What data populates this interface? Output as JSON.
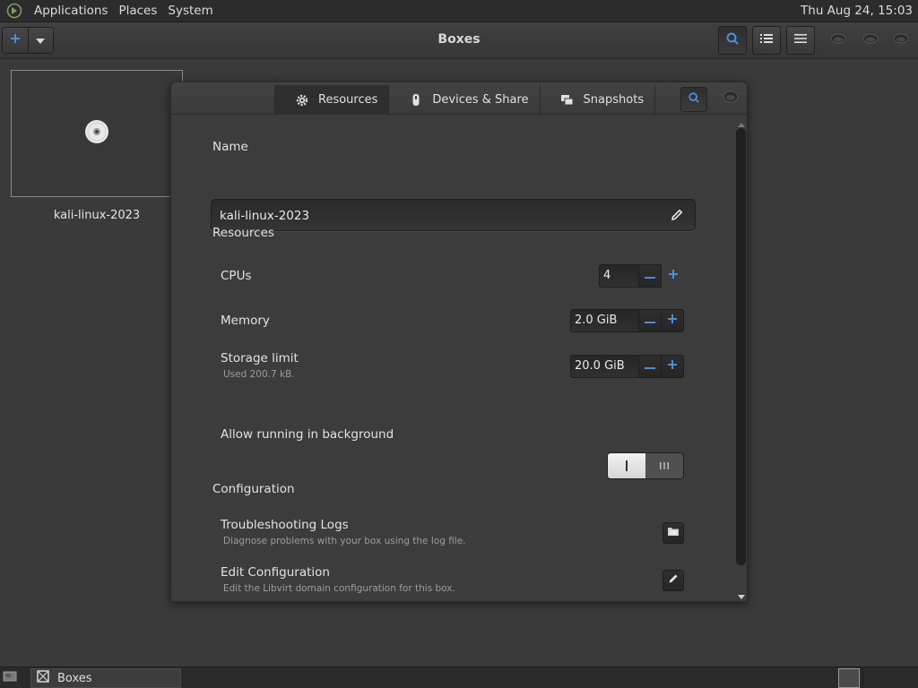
{
  "top_panel": {
    "menus": [
      "Applications",
      "Places",
      "System"
    ],
    "clock": "Thu Aug 24, 15:03"
  },
  "header": {
    "title": "Boxes"
  },
  "boxes": [
    {
      "name": "kali-linux-2023"
    }
  ],
  "dialog": {
    "tabs": [
      {
        "label": "Resources",
        "icon": "gear-icon",
        "active": true
      },
      {
        "label": "Devices & Share",
        "icon": "usb-device-icon",
        "active": false
      },
      {
        "label": "Snapshots",
        "icon": "snapshots-icon",
        "active": false
      }
    ],
    "name_section": {
      "title": "Name",
      "value": "kali-linux-2023"
    },
    "resources_section": {
      "title": "Resources",
      "cpus": {
        "label": "CPUs",
        "value": "4"
      },
      "memory": {
        "label": "Memory",
        "value": "2.0 GiB"
      },
      "storage": {
        "label": "Storage limit",
        "sublabel": "Used 200.7 kB.",
        "value": "20.0 GiB"
      },
      "background": {
        "label": "Allow running in background",
        "enabled": true
      }
    },
    "configuration_section": {
      "title": "Configuration",
      "logs": {
        "label": "Troubleshooting Logs",
        "sublabel": "Diagnose problems with your box using the log file."
      },
      "edit": {
        "label": "Edit Configuration",
        "sublabel": "Edit the Libvirt domain configuration for this box."
      }
    }
  },
  "taskbar": {
    "task_label": "Boxes"
  },
  "colors": {
    "accent_blue": "#4a8fe0",
    "panel": "#2c2c2c",
    "background": "#3a3a3a"
  }
}
